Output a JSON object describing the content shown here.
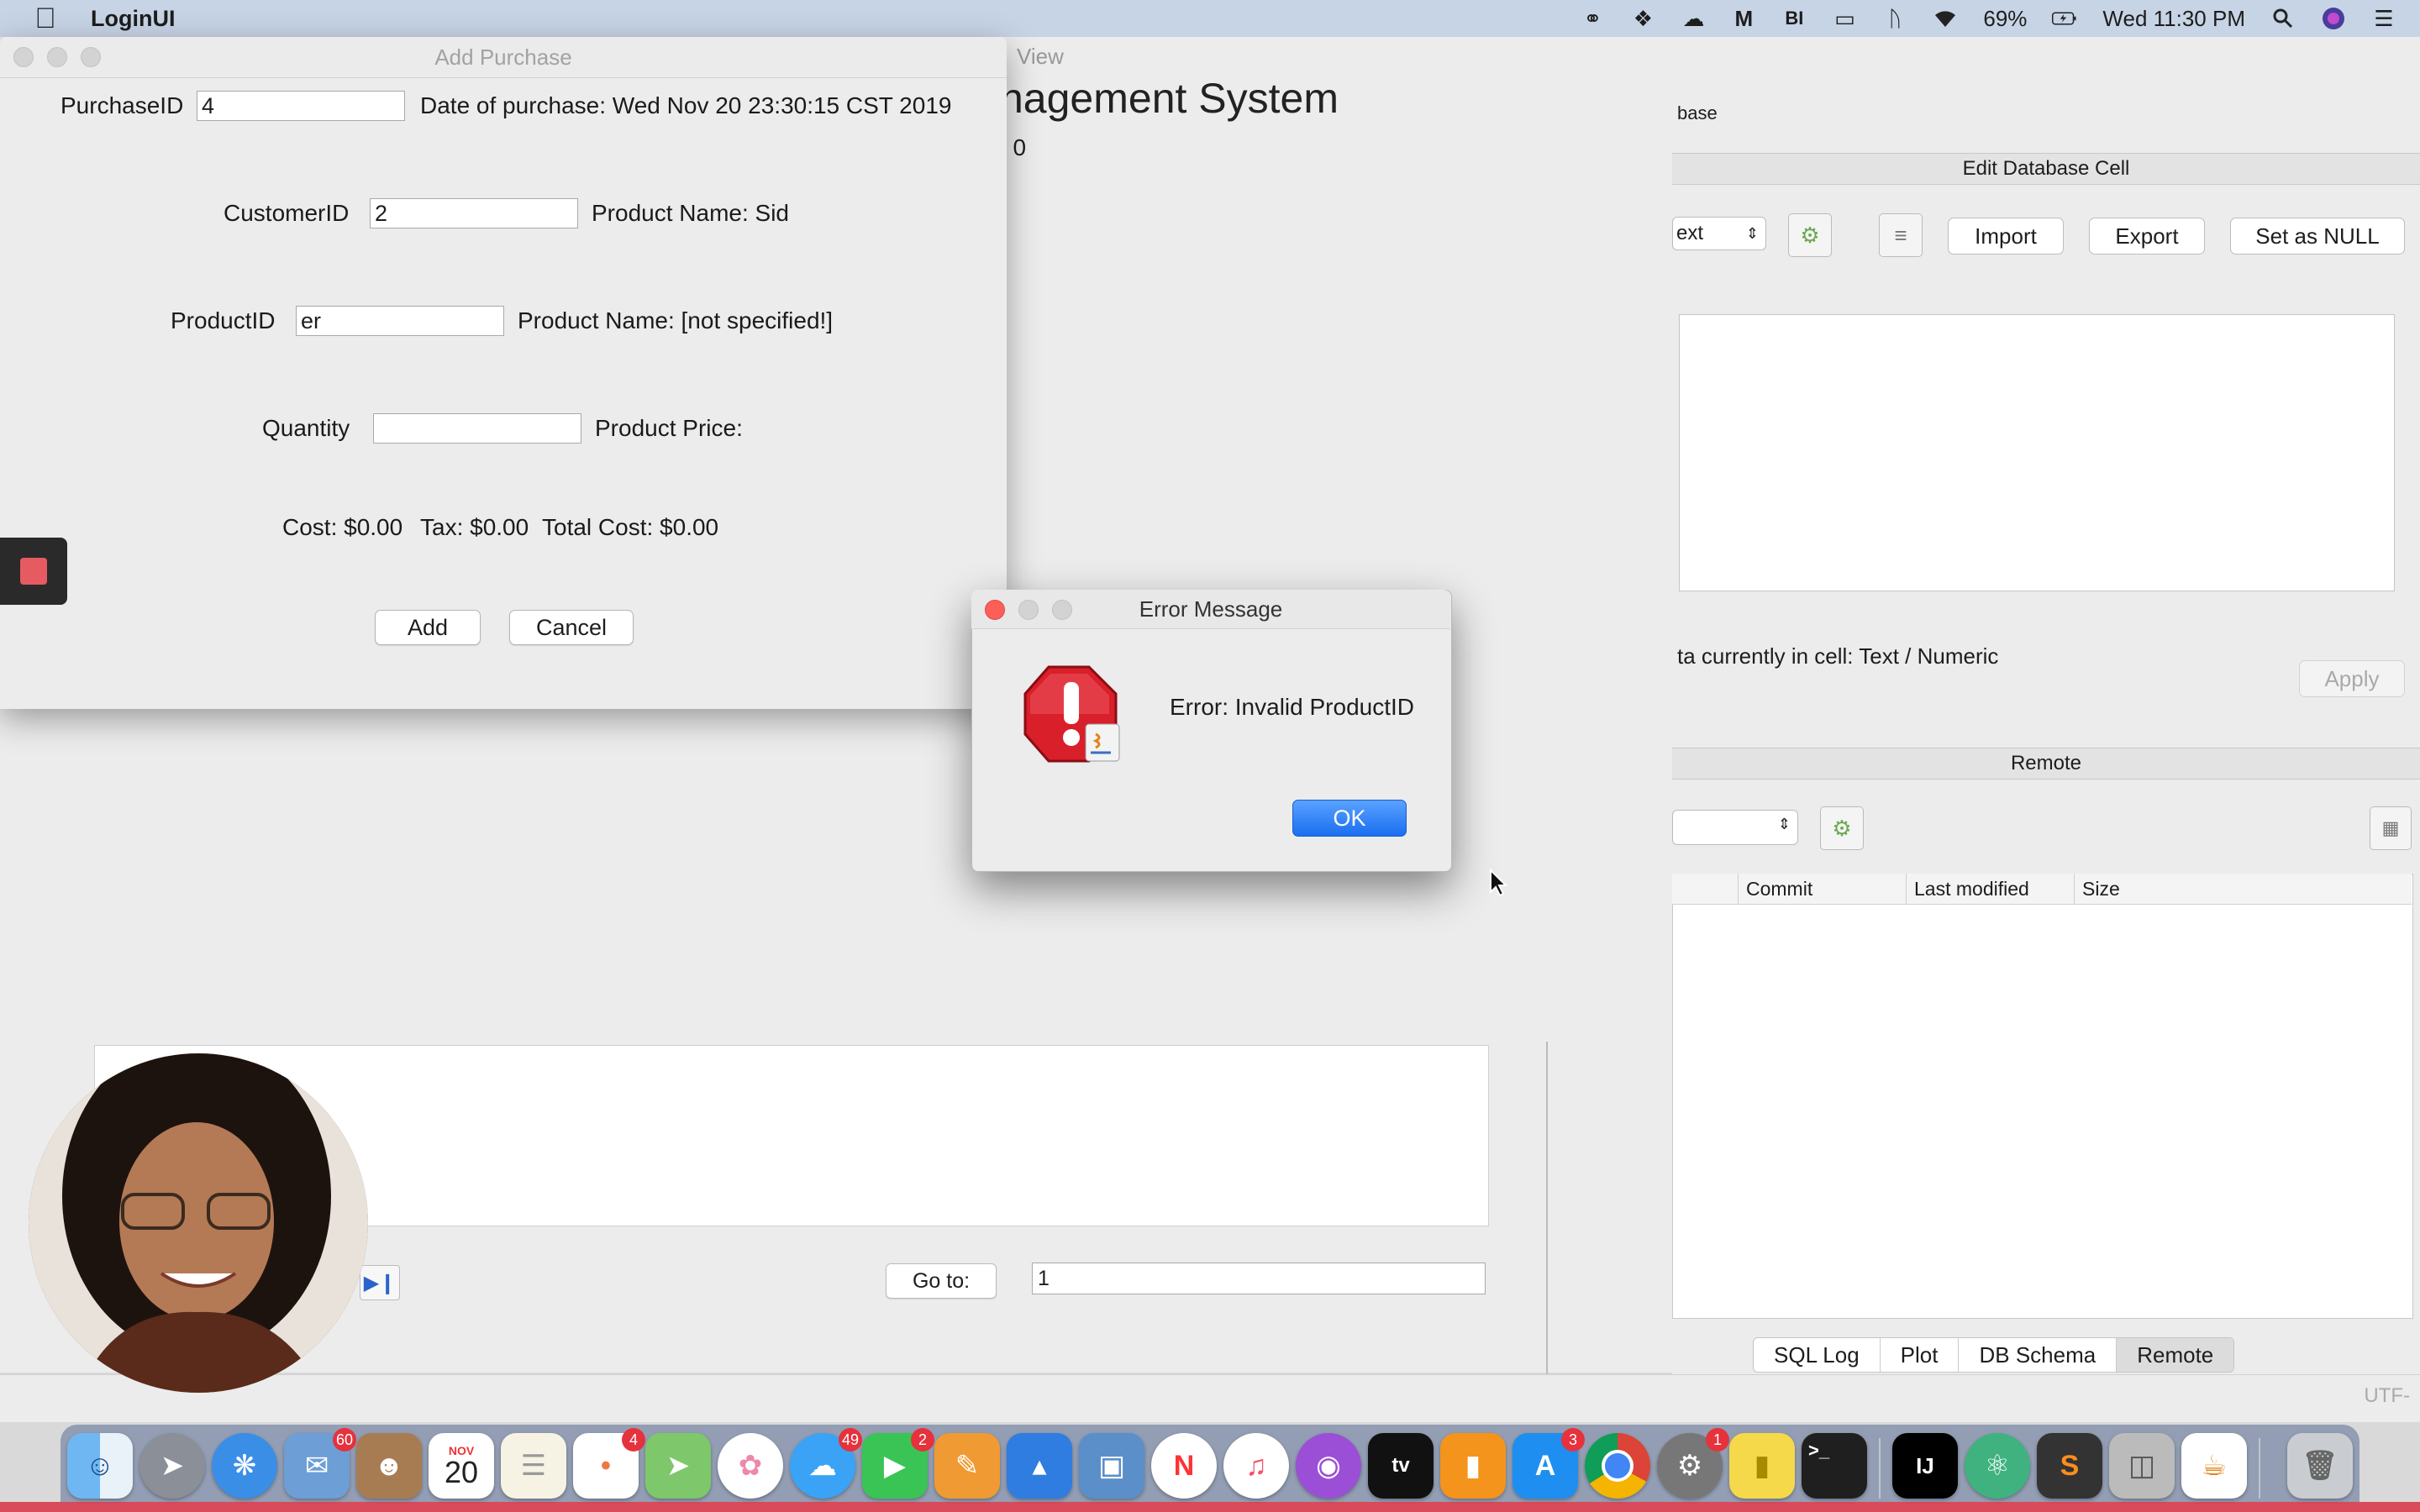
{
  "menubar": {
    "app_name": "LoginUI",
    "battery": "69%",
    "clock": "Wed 11:30 PM",
    "icons": [
      "apple-icon",
      "creative-cloud-icon",
      "dropbox-icon",
      "cloud-icon",
      "gmail-icon",
      "bold-icon",
      "airplay-icon",
      "bluetooth-icon",
      "wifi-icon",
      "battery-icon",
      "search-icon",
      "siri-icon",
      "list-icon"
    ]
  },
  "main_window": {
    "title_fragment": "View",
    "heading_fragment": "nagement System",
    "count_fragment": ": 0",
    "goto_label": "Go to:",
    "goto_value": "1"
  },
  "db_window": {
    "title_fragment": "base",
    "edit_cell_title": "Edit Database Cell",
    "mode_value": "ext",
    "import_label": "Import",
    "export_label": "Export",
    "set_null_label": "Set as NULL",
    "cell_type_text": "ta currently in cell: Text / Numeric",
    "apply_label": "Apply",
    "remote_title": "Remote",
    "remote_columns": [
      "Commit",
      "Last modified",
      "Size"
    ],
    "tabs": [
      "SQL Log",
      "Plot",
      "DB Schema",
      "Remote"
    ],
    "active_tab": "Remote",
    "encoding": "UTF-"
  },
  "add_purchase": {
    "title": "Add Purchase",
    "purchase_id_label": "PurchaseID",
    "purchase_id_value": "4",
    "date_text": "Date of purchase: Wed Nov 20 23:30:15 CST 2019",
    "customer_id_label": "CustomerID",
    "customer_id_value": "2",
    "customer_name_text": "Product Name: Sid",
    "product_id_label": "ProductID",
    "product_id_value": "er",
    "product_name_text": "Product Name: [not specified!]",
    "quantity_label": "Quantity",
    "quantity_value": "",
    "product_price_text": "Product Price:",
    "cost_text": "Cost: $0.00",
    "tax_text": "Tax: $0.00",
    "total_text": "Total Cost: $0.00",
    "add_label": "Add",
    "cancel_label": "Cancel"
  },
  "error_dialog": {
    "title": "Error Message",
    "message": "Error: Invalid ProductID",
    "ok_label": "OK"
  },
  "dock": {
    "calendar_month": "NOV",
    "calendar_day": "20",
    "apps": [
      {
        "name": "finder",
        "badge": ""
      },
      {
        "name": "launchpad",
        "badge": ""
      },
      {
        "name": "safari",
        "badge": ""
      },
      {
        "name": "mail",
        "badge": "60"
      },
      {
        "name": "contacts",
        "badge": ""
      },
      {
        "name": "calendar",
        "badge": ""
      },
      {
        "name": "notes",
        "badge": ""
      },
      {
        "name": "reminders",
        "badge": "4"
      },
      {
        "name": "maps",
        "badge": ""
      },
      {
        "name": "photos",
        "badge": ""
      },
      {
        "name": "messages",
        "badge": "49"
      },
      {
        "name": "facetime",
        "badge": "2"
      },
      {
        "name": "pages",
        "badge": ""
      },
      {
        "name": "keynote",
        "badge": ""
      },
      {
        "name": "preview",
        "badge": ""
      },
      {
        "name": "news",
        "badge": ""
      },
      {
        "name": "music",
        "badge": ""
      },
      {
        "name": "podcasts",
        "badge": ""
      },
      {
        "name": "tv",
        "badge": ""
      },
      {
        "name": "books",
        "badge": ""
      },
      {
        "name": "app-store",
        "badge": "3"
      },
      {
        "name": "chrome",
        "badge": ""
      },
      {
        "name": "system-preferences",
        "badge": "1"
      },
      {
        "name": "stickies",
        "badge": ""
      },
      {
        "name": "terminal",
        "badge": ""
      },
      {
        "name": "intellij",
        "badge": ""
      },
      {
        "name": "atom",
        "badge": ""
      },
      {
        "name": "sublime",
        "badge": ""
      },
      {
        "name": "db-browser",
        "badge": ""
      },
      {
        "name": "java",
        "badge": ""
      },
      {
        "name": "trash",
        "badge": ""
      }
    ]
  }
}
